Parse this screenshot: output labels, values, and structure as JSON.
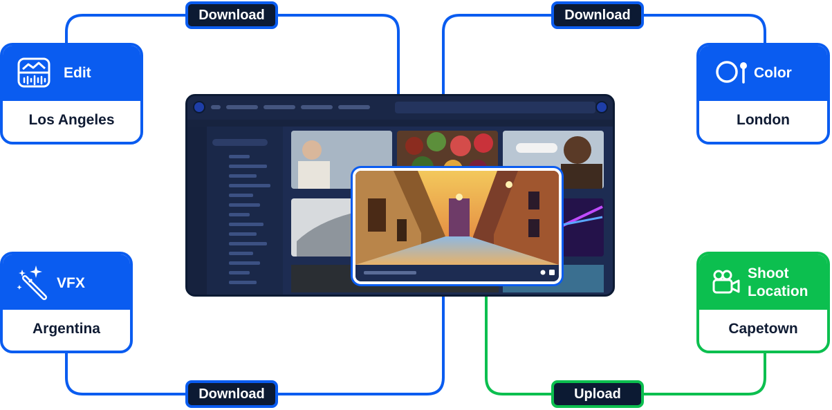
{
  "connectors": {
    "download_top_left": "Download",
    "download_top_right": "Download",
    "download_bottom": "Download",
    "upload": "Upload"
  },
  "locations": [
    {
      "role": "Edit",
      "city": "Los Angeles",
      "icon": "waveform-editor-icon"
    },
    {
      "role": "Color",
      "city": "London",
      "icon": "color-palette-icon"
    },
    {
      "role": "VFX",
      "city": "Argentina",
      "icon": "magic-wand-icon"
    },
    {
      "role_line1": "Shoot",
      "role_line2": "Location",
      "city": "Capetown",
      "icon": "video-camera-icon"
    }
  ],
  "colors": {
    "blue": "#0a5cf0",
    "green": "#0cbf4f",
    "navy": "#0c1a33"
  }
}
